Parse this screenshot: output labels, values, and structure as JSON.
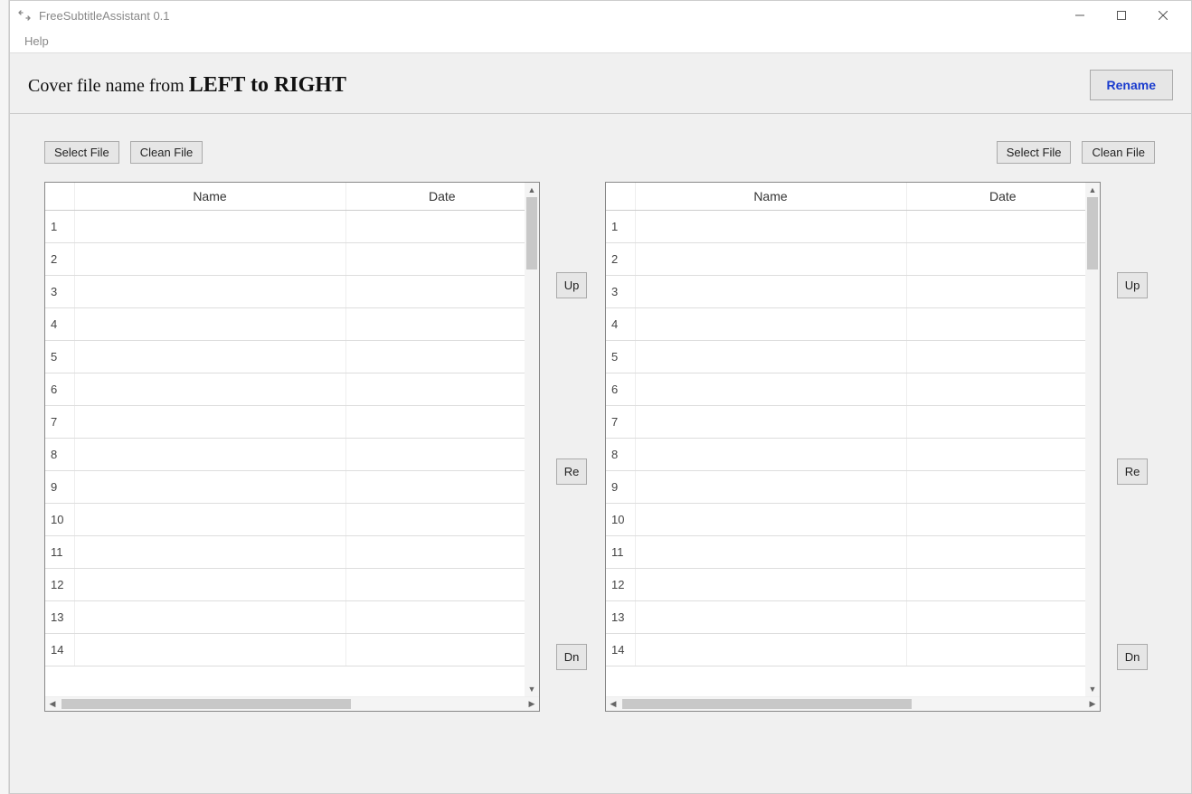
{
  "window": {
    "title": "FreeSubtitleAssistant 0.1"
  },
  "menu": {
    "help": "Help"
  },
  "header": {
    "prefix": "Cover file name from ",
    "bold": "LEFT to RIGHT",
    "rename": "Rename"
  },
  "buttons": {
    "select_file": "Select File",
    "clean_file": "Clean File",
    "up": "Up",
    "re": "Re",
    "dn": "Dn"
  },
  "columns": {
    "name": "Name",
    "date": "Date"
  },
  "left_table": {
    "rows": [
      {
        "n": "1",
        "name": "",
        "date": ""
      },
      {
        "n": "2",
        "name": "",
        "date": ""
      },
      {
        "n": "3",
        "name": "",
        "date": ""
      },
      {
        "n": "4",
        "name": "",
        "date": ""
      },
      {
        "n": "5",
        "name": "",
        "date": ""
      },
      {
        "n": "6",
        "name": "",
        "date": ""
      },
      {
        "n": "7",
        "name": "",
        "date": ""
      },
      {
        "n": "8",
        "name": "",
        "date": ""
      },
      {
        "n": "9",
        "name": "",
        "date": ""
      },
      {
        "n": "10",
        "name": "",
        "date": ""
      },
      {
        "n": "11",
        "name": "",
        "date": ""
      },
      {
        "n": "12",
        "name": "",
        "date": ""
      },
      {
        "n": "13",
        "name": "",
        "date": ""
      },
      {
        "n": "14",
        "name": "",
        "date": ""
      }
    ]
  },
  "right_table": {
    "rows": [
      {
        "n": "1",
        "name": "",
        "date": ""
      },
      {
        "n": "2",
        "name": "",
        "date": ""
      },
      {
        "n": "3",
        "name": "",
        "date": ""
      },
      {
        "n": "4",
        "name": "",
        "date": ""
      },
      {
        "n": "5",
        "name": "",
        "date": ""
      },
      {
        "n": "6",
        "name": "",
        "date": ""
      },
      {
        "n": "7",
        "name": "",
        "date": ""
      },
      {
        "n": "8",
        "name": "",
        "date": ""
      },
      {
        "n": "9",
        "name": "",
        "date": ""
      },
      {
        "n": "10",
        "name": "",
        "date": ""
      },
      {
        "n": "11",
        "name": "",
        "date": ""
      },
      {
        "n": "12",
        "name": "",
        "date": ""
      },
      {
        "n": "13",
        "name": "",
        "date": ""
      },
      {
        "n": "14",
        "name": "",
        "date": ""
      }
    ]
  }
}
